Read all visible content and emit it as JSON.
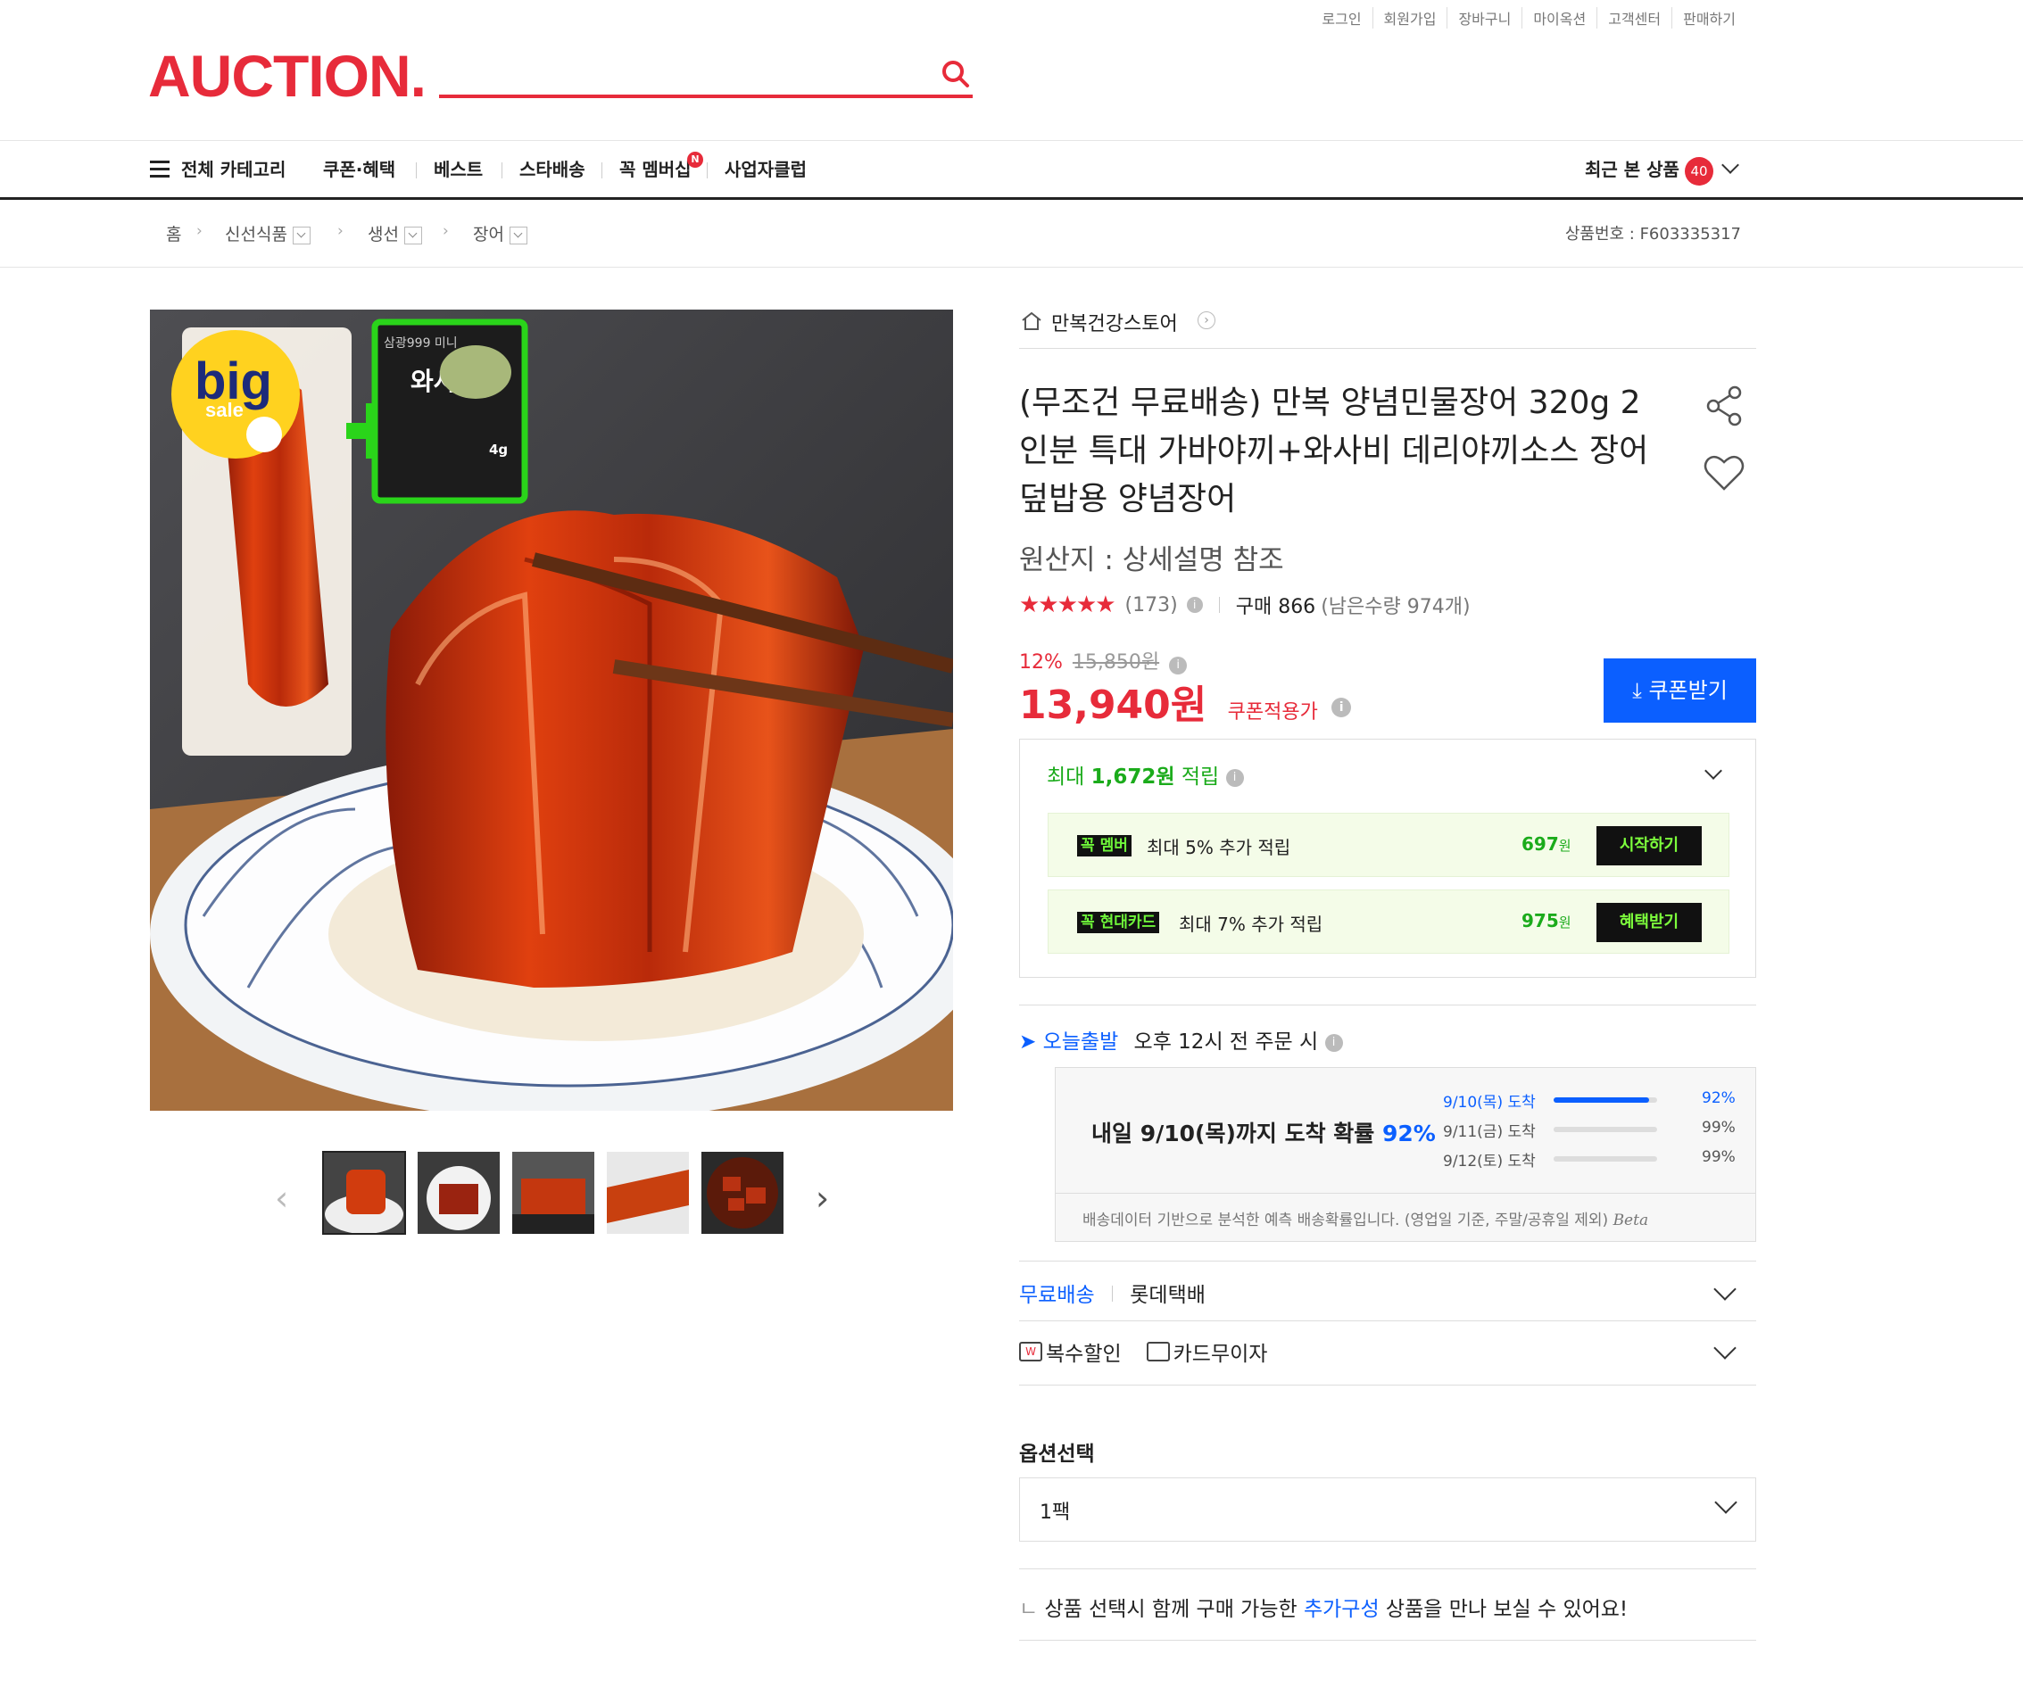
{
  "top_links": [
    "로그인",
    "회원가입",
    "장바구니",
    "마이옥션",
    "고객센터",
    "판매하기"
  ],
  "logo": "AUCTION.",
  "nav": {
    "all_categories": "전체 카테고리",
    "items": [
      "쿠폰·혜택",
      "베스트",
      "스타배송",
      "꼭 멤버십",
      "사업자클럽"
    ],
    "member_badge": "N",
    "recent_label": "최근 본 상품",
    "recent_count": "40"
  },
  "breadcrumb": {
    "home": "홈",
    "levels": [
      "신선식품",
      "생선",
      "장어"
    ]
  },
  "product_no": "상품번호 : F603335317",
  "image_overlay": {
    "big": "big",
    "sale": "sale",
    "pack_title": "삼광999 미니",
    "pack_brand": "와사비",
    "pack_weight": "4g"
  },
  "store_name": "만복건강스토어",
  "title": "(무조건 무료배송) 만복 양념민물장어 320g 2인분 특대 가바야끼+와사비 데리야끼소스 장어덮밥용 양념장어",
  "origin": "원산지 : 상세설명 참조",
  "rating": {
    "stars": 4.5,
    "count": "(173)",
    "purchase": "구매 866",
    "remaining": "(남은수량 974개)"
  },
  "price": {
    "discount": "12%",
    "original": "15,850원",
    "final": "13,940원",
    "coupon_note": "쿠폰적용가"
  },
  "coupon_button": "쿠폰받기",
  "points": {
    "prefix": "최대 ",
    "amount": "1,672원",
    "suffix": " 적립",
    "rows": [
      {
        "badge_a": "꼭",
        "badge_b": "멤버",
        "desc": "최대 5% 추가 적립",
        "value": "697",
        "unit": "원",
        "button": "시작하기"
      },
      {
        "badge_a": "꼭",
        "badge_b": "현대카드",
        "desc": "최대 7% 추가 적립",
        "value": "975",
        "unit": "원",
        "button": "혜택받기"
      }
    ]
  },
  "delivery": {
    "today": "오늘출발",
    "cutoff": "오후 12시 전 주문 시",
    "headline_a": "내일 9/10(목)까지 도착 확률 ",
    "headline_b": "92%",
    "rows": [
      {
        "date": "9/10(목) 도착",
        "pct": "92%",
        "fill": 0.92,
        "active": true
      },
      {
        "date": "9/11(금) 도착",
        "pct": "99%",
        "fill": 0.99,
        "active": false
      },
      {
        "date": "9/12(토) 도착",
        "pct": "99%",
        "fill": 0.99,
        "active": false
      }
    ],
    "note": "배송데이터 기반으로 분석한 예측 배송확률입니다. (영업일 기준, 주말/공휴일 제외)",
    "beta": "Beta"
  },
  "shipping": {
    "free": "무료배송",
    "carrier": "롯데택배"
  },
  "benefits": {
    "multi": "복수할인",
    "card": "카드무이자"
  },
  "option": {
    "label": "옵션선택",
    "value": "1팩"
  },
  "addon": {
    "a": "상품 선택시 함께 구매 가능한 ",
    "link": "추가구성",
    "b": " 상품을 만나 보실 수 있어요!"
  },
  "colors": {
    "brand": "#e72b3a",
    "blue": "#0b5fff",
    "green": "#1bab1b"
  }
}
